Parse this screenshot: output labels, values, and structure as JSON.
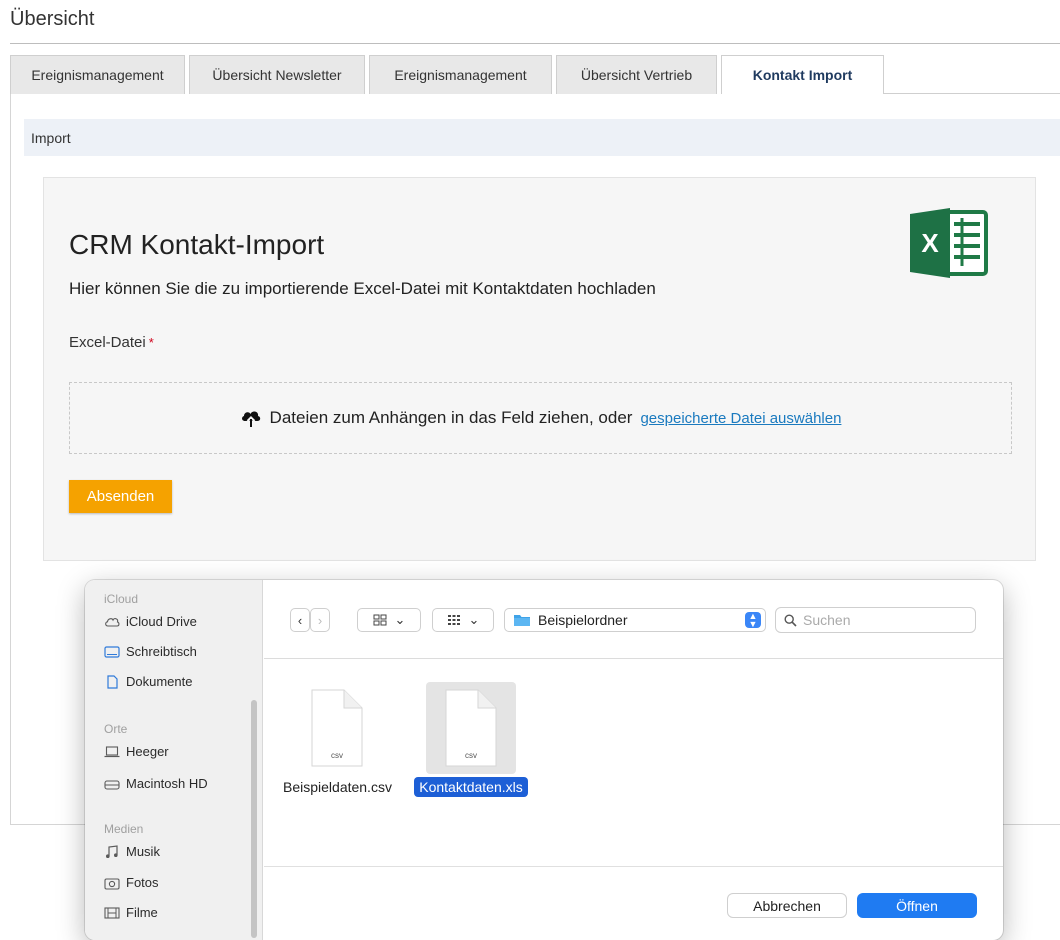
{
  "page": {
    "title": "Übersicht"
  },
  "tabs": [
    {
      "label": "Ereignismanagement",
      "active": false
    },
    {
      "label": "Übersicht Newsletter",
      "active": false
    },
    {
      "label": "Ereignismanagement",
      "active": false
    },
    {
      "label": "Übersicht Vertrieb",
      "active": false
    },
    {
      "label": "Kontakt Import",
      "active": true
    }
  ],
  "section": {
    "label": "Import"
  },
  "form": {
    "title": "CRM Kontakt-Import",
    "subtitle": "Hier können Sie die zu importierende Excel-Datei mit Kontaktdaten hochladen",
    "field_label": "Excel-Datei",
    "required_mark": "*",
    "dropzone_text": "Dateien zum Anhängen in das Feld ziehen, oder",
    "dropzone_link": "gespeicherte Datei auswählen",
    "submit_label": "Absenden",
    "logo_icon": "excel-logo",
    "accent_color": "#f5a200"
  },
  "dialog": {
    "sidebar": {
      "sections": [
        {
          "heading": "iCloud",
          "items": [
            {
              "label": "iCloud Drive",
              "icon": "cloud-icon"
            },
            {
              "label": "Schreibtisch",
              "icon": "desktop-icon"
            },
            {
              "label": "Dokumente",
              "icon": "document-icon"
            }
          ]
        },
        {
          "heading": "Orte",
          "items": [
            {
              "label": "Heeger",
              "icon": "laptop-icon"
            },
            {
              "label": "Macintosh HD",
              "icon": "hard-drive-icon"
            }
          ]
        },
        {
          "heading": "Medien",
          "items": [
            {
              "label": "Musik",
              "icon": "music-icon"
            },
            {
              "label": "Fotos",
              "icon": "camera-icon"
            },
            {
              "label": "Filme",
              "icon": "film-icon"
            }
          ]
        }
      ]
    },
    "toolbar": {
      "back_icon": "chevron-left-icon",
      "forward_icon": "chevron-right-icon",
      "view_icon": "grid-view-icon",
      "group_icon": "group-view-icon",
      "folder_name": "Beispielordner",
      "search_placeholder": "Suchen"
    },
    "files": [
      {
        "name": "Beispieldaten.csv",
        "type_label": "csv",
        "selected": false
      },
      {
        "name": "Kontaktdaten.xls",
        "type_label": "csv",
        "selected": true
      }
    ],
    "buttons": {
      "cancel": "Abbrechen",
      "open": "Öffnen"
    },
    "selection_color": "#1d5fd6"
  }
}
